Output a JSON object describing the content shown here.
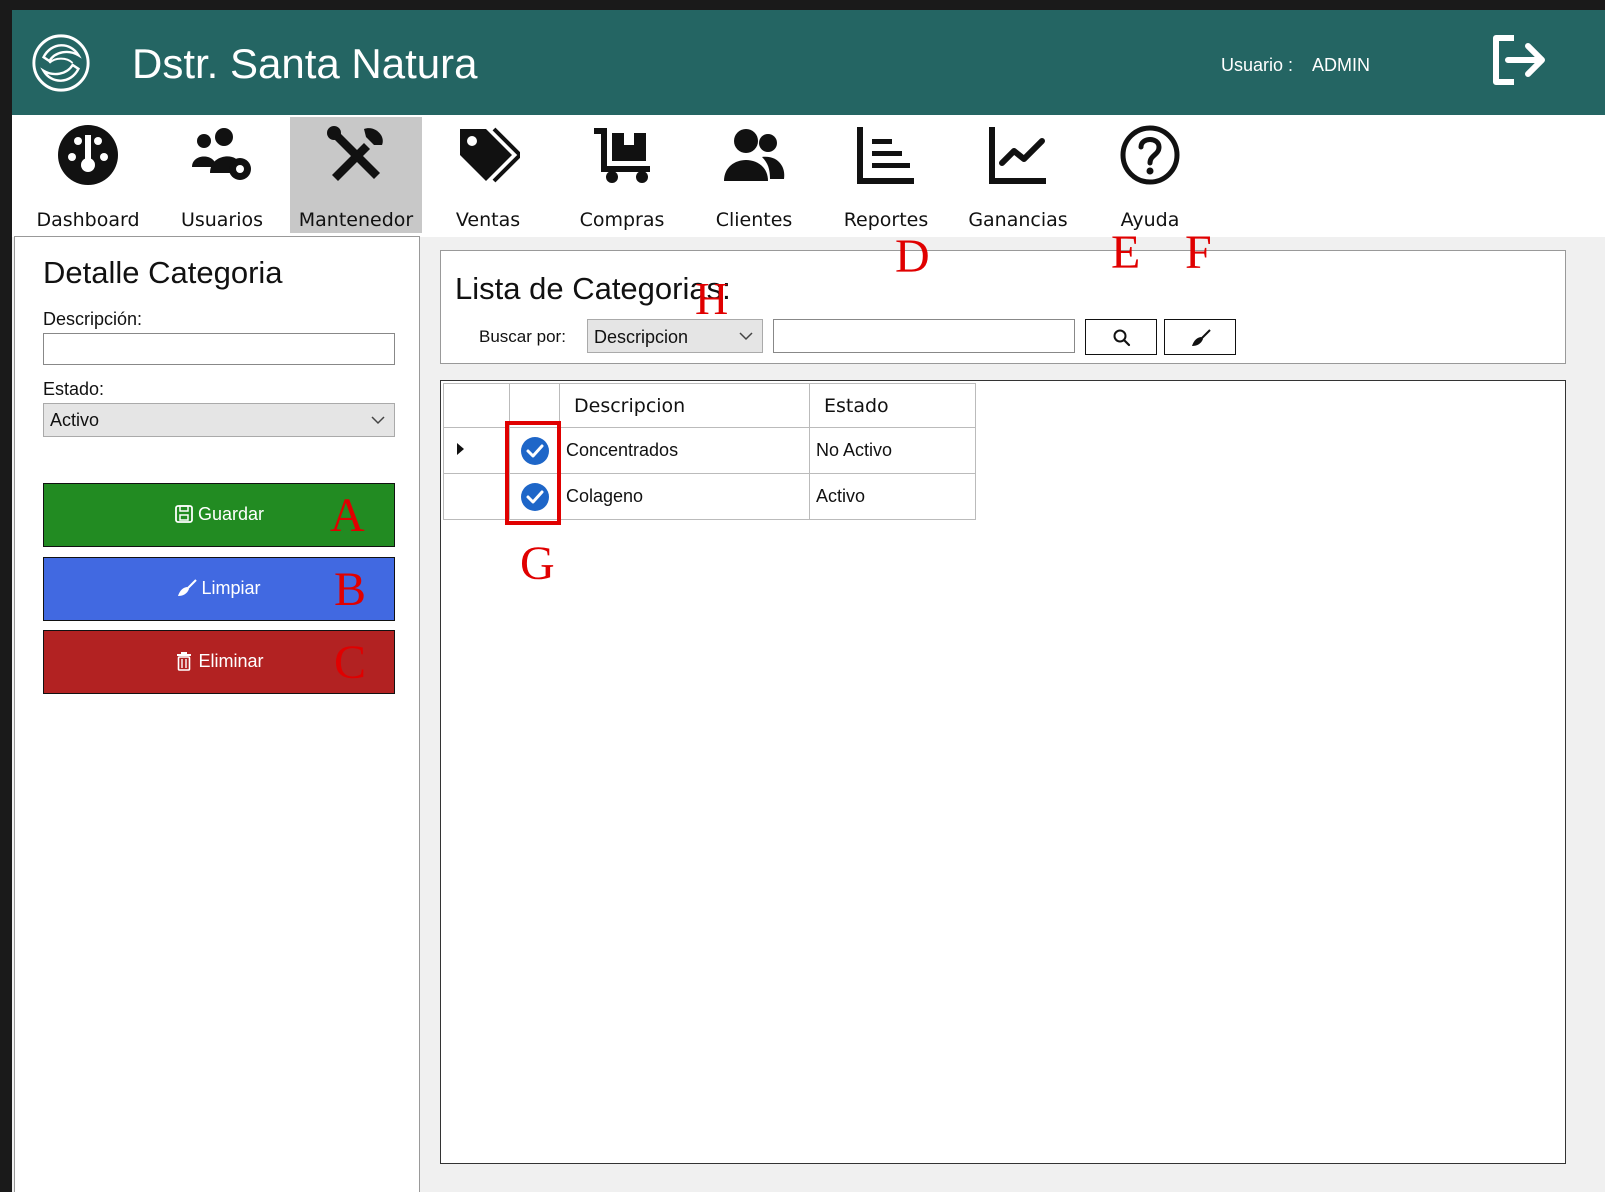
{
  "header": {
    "app_title": "Dstr. Santa Natura",
    "user_label": "Usuario :",
    "user_name": "ADMIN",
    "logout_icon": "logout-icon",
    "bg_color": "#246563"
  },
  "menu": {
    "items": [
      {
        "label": "Dashboard",
        "icon": "gauge-icon"
      },
      {
        "label": "Usuarios",
        "icon": "users-gear-icon"
      },
      {
        "label": "Mantenedor",
        "icon": "tools-icon",
        "active": true
      },
      {
        "label": "Ventas",
        "icon": "tags-icon"
      },
      {
        "label": "Compras",
        "icon": "dolly-icon"
      },
      {
        "label": "Clientes",
        "icon": "user-group-icon"
      },
      {
        "label": "Reportes",
        "icon": "bars-chart-icon"
      },
      {
        "label": "Ganancias",
        "icon": "line-chart-icon"
      },
      {
        "label": "Ayuda",
        "icon": "question-icon"
      }
    ]
  },
  "detail": {
    "title": "Detalle Categoria",
    "descripcion_label": "Descripción:",
    "descripcion_value": "",
    "estado_label": "Estado:",
    "estado_value": "Activo",
    "buttons": {
      "guardar": "Guardar",
      "limpiar": "Limpiar",
      "eliminar": "Eliminar"
    },
    "button_colors": {
      "guardar": "#228b22",
      "limpiar": "#4169e1",
      "eliminar": "#b22222"
    }
  },
  "list": {
    "title": "Lista de Categorias:",
    "buscar_label": "Buscar por:",
    "buscar_select": "Descripcion",
    "buscar_value": "",
    "columns": [
      "Descripcion",
      "Estado"
    ],
    "rows": [
      {
        "descripcion": "Concentrados",
        "estado": "No Activo",
        "checked": true
      },
      {
        "descripcion": "Colageno",
        "estado": "Activo",
        "checked": true
      }
    ]
  },
  "annotations": {
    "A": "A",
    "B": "B",
    "C": "C",
    "D": "D",
    "E": "E",
    "F": "F",
    "G": "G",
    "H": "H",
    "color": "#e00000"
  }
}
